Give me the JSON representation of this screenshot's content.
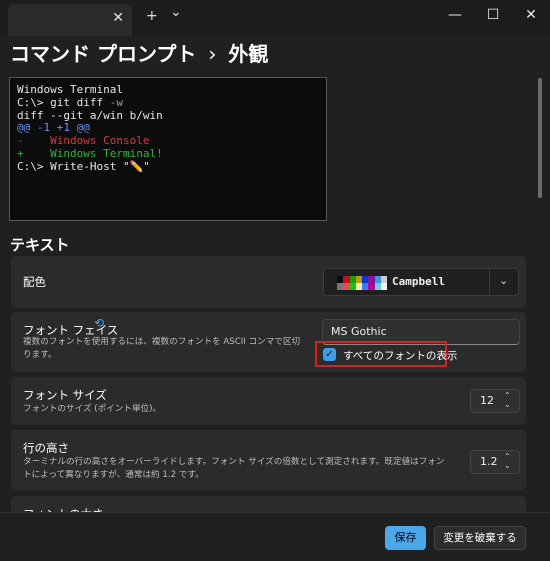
{
  "titlebar": {
    "tab_close": "✕",
    "new_tab": "+",
    "dropdown": "⌄",
    "minimize": "—",
    "maximize": "☐",
    "close": "✕"
  },
  "breadcrumb": {
    "profile": "コマンド プロンプト",
    "separator": "›",
    "page": "外観"
  },
  "preview": {
    "line1": "Windows Terminal",
    "line2_prompt": "C:\\> ",
    "line2_cmd": "git diff ",
    "line2_flag": "-w",
    "line3": "diff --git a/win b/win",
    "line4": "@@ -1 +1 @@",
    "line5": "-    Windows Console",
    "line6": "+    Windows Terminal!",
    "line7": "C:\\> Write-Host \"✏️\"",
    "colors": {
      "text": "#e6e6e6",
      "muted": "#9a9a9a",
      "hunk": "#6c8ff5",
      "removed": "#d23b3b",
      "added": "#2fb535"
    }
  },
  "section": {
    "text": "テキスト"
  },
  "color_scheme": {
    "label": "配色",
    "value": "Campbell",
    "swatches": [
      "#0c0c0c",
      "#c50f1f",
      "#13a10e",
      "#c19c00",
      "#0037da",
      "#881798",
      "#3a96dd",
      "#cccccc",
      "#767676",
      "#e74856",
      "#16c60c",
      "#f9f1a5",
      "#3b78ff",
      "#b4009e",
      "#61d6d6",
      "#f2f2f2"
    ]
  },
  "font_face": {
    "label": "フォント フェイス",
    "desc": "複数のフォントを使用するには、複数のフォントを ASCII コンマで区切ります。",
    "value": "MS Gothic",
    "show_all_label": "すべてのフォントの表示",
    "show_all_checked": true
  },
  "font_size": {
    "label": "フォント サイズ",
    "desc": "フォントのサイズ (ポイント単位)。",
    "value": "12"
  },
  "line_height": {
    "label": "行の高さ",
    "desc": "ターミナルの行の高さをオーバーライドします。フォント サイズの倍数として測定されます。既定値はフォントによって異なりますが、通常は約 1.2 です。",
    "value": "1.2"
  },
  "font_weight": {
    "label": "フォントの太さ"
  },
  "actions": {
    "save": "保存",
    "discard": "変更を破棄する"
  },
  "accent": "#4aa8e8",
  "highlight": "#e21b1b"
}
